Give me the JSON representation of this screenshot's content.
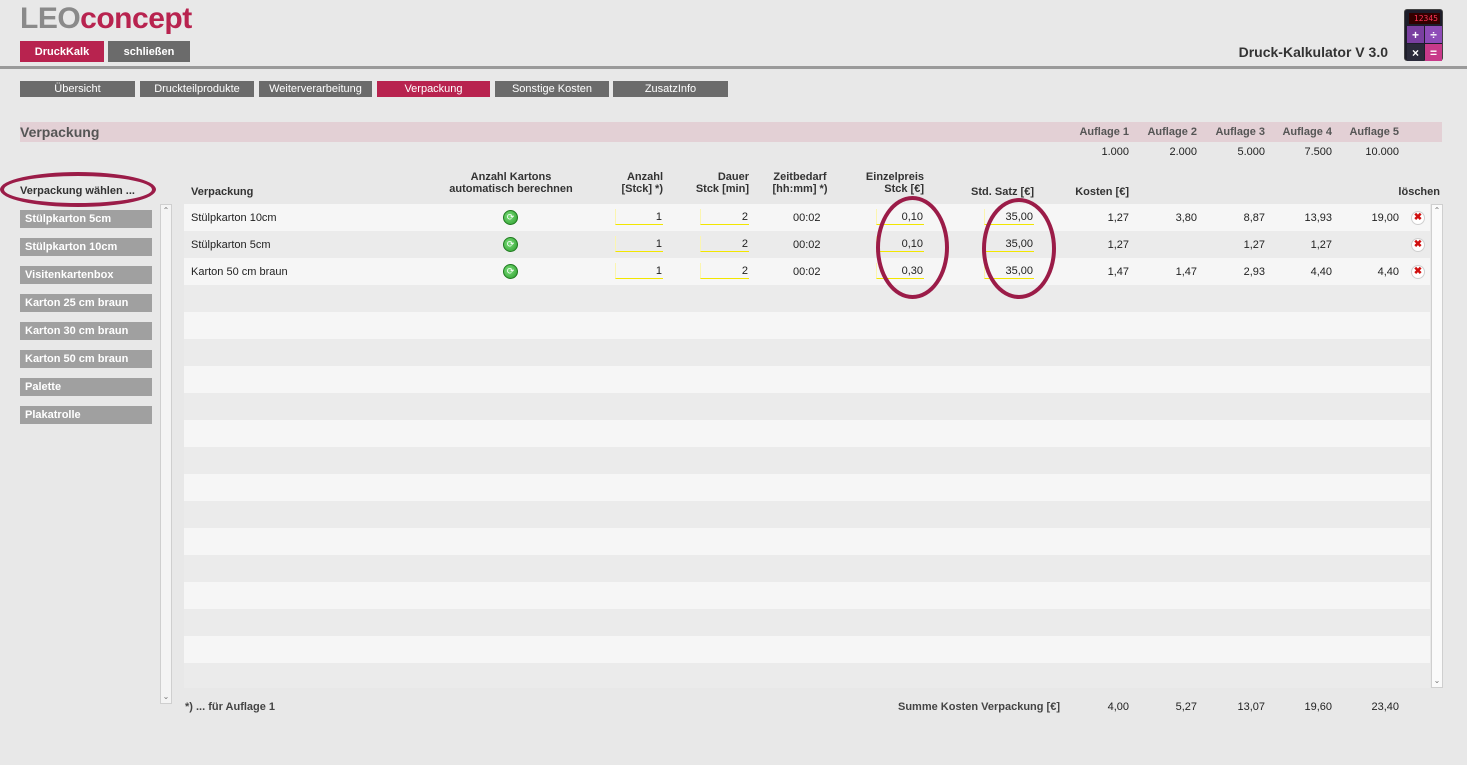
{
  "logo": {
    "leo": "LEO",
    "concept": "concept"
  },
  "top_buttons": {
    "druckkalk": "DruckKalk",
    "schliessen": "schließen"
  },
  "app_title": "Druck-Kalkulator V 3.0",
  "calculator_icon": {
    "display": "12345",
    "keys": [
      "+",
      "÷",
      "×",
      "="
    ]
  },
  "tabs": [
    "Übersicht",
    "Druckteilprodukte",
    "Weiterverarbeitung",
    "Verpackung",
    "Sonstige Kosten",
    "ZusatzInfo"
  ],
  "active_tab": "Verpackung",
  "section": {
    "title": "Verpackung",
    "auflagen": [
      {
        "label": "Auflage 1",
        "value": "1.000"
      },
      {
        "label": "Auflage 2",
        "value": "2.000"
      },
      {
        "label": "Auflage 3",
        "value": "5.000"
      },
      {
        "label": "Auflage 4",
        "value": "7.500"
      },
      {
        "label": "Auflage 5",
        "value": "10.000"
      }
    ]
  },
  "sidebar": {
    "heading": "Verpackung wählen ...",
    "items": [
      "Stülpkarton 5cm",
      "Stülpkarton 10cm",
      "Visitenkartenbox",
      "Karton 25 cm braun",
      "Karton 30 cm braun",
      "Karton 50 cm braun",
      "Palette",
      "Plakatrolle"
    ]
  },
  "table": {
    "headers": {
      "verpackung": "Verpackung",
      "auto_kartons_1": "Anzahl Kartons",
      "auto_kartons_2": "automatisch berechnen",
      "anzahl_1": "Anzahl",
      "anzahl_2": "[Stck] *)",
      "dauer_1": "Dauer",
      "dauer_2": "Stck [min]",
      "zeit_1": "Zeitbedarf",
      "zeit_2": "[hh:mm] *)",
      "einzel_1": "Einzelpreis",
      "einzel_2": "Stck [€]",
      "std_satz": "Std. Satz [€]",
      "kosten": "Kosten [€]",
      "loeschen": "löschen"
    },
    "rows": [
      {
        "name": "Stülpkarton 10cm",
        "anzahl": "1",
        "dauer": "2",
        "zeit": "00:02",
        "einzelpreis": "0,10",
        "std_satz": "35,00",
        "kosten": [
          "1,27",
          "3,80",
          "8,87",
          "13,93",
          "19,00"
        ]
      },
      {
        "name": "Stülpkarton 5cm",
        "anzahl": "1",
        "dauer": "2",
        "zeit": "00:02",
        "einzelpreis": "0,10",
        "std_satz": "35,00",
        "kosten": [
          "1,27",
          "",
          "1,27",
          "1,27",
          ""
        ]
      },
      {
        "name": "Karton 50 cm braun",
        "anzahl": "1",
        "dauer": "2",
        "zeit": "00:02",
        "einzelpreis": "0,30",
        "std_satz": "35,00",
        "kosten": [
          "1,47",
          "1,47",
          "2,93",
          "4,40",
          "4,40"
        ]
      }
    ]
  },
  "footer": {
    "note": "*) ... für Auflage 1",
    "summe_label": "Summe Kosten Verpackung [€]",
    "summen": [
      "4,00",
      "5,27",
      "13,07",
      "19,60",
      "23,40"
    ]
  },
  "colors": {
    "brand": "#b8234f",
    "tab_inactive": "#6b6b6b",
    "section_bar": "#e3d0d5",
    "highlight_circle": "#9b1c48"
  }
}
